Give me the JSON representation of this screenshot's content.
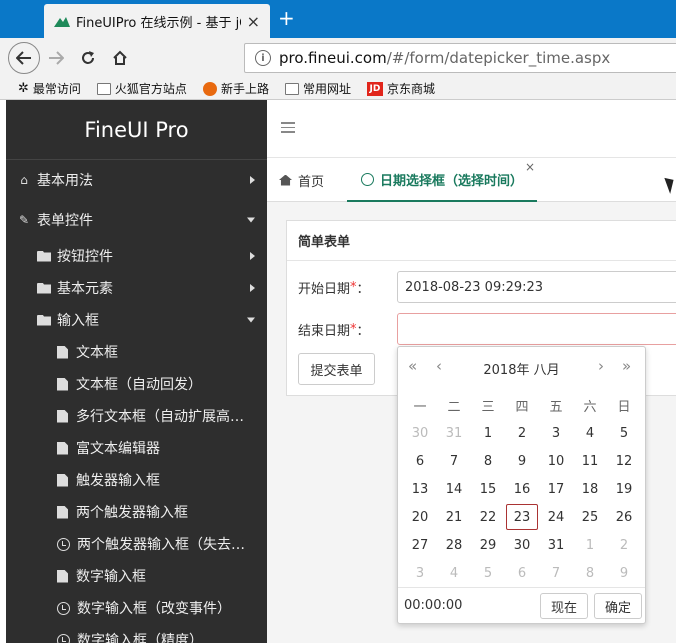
{
  "browser": {
    "tab_title": "FineUIPro 在线示例 - 基于 jQuery",
    "tab_close": "×",
    "new_tab": "+",
    "url_host": "pro.fineui.com",
    "url_path": "/#/form/datepicker_time.aspx",
    "bookmarks": [
      "最常访问",
      "火狐官方站点",
      "新手上路",
      "常用网址",
      "京东商城"
    ],
    "jd_logo": "JD"
  },
  "sidebar": {
    "brand": "FineUI Pro",
    "items": [
      {
        "label": "基本用法"
      },
      {
        "label": "表单控件"
      },
      {
        "label": "按钮控件"
      },
      {
        "label": "基本元素"
      },
      {
        "label": "输入框"
      },
      {
        "label": "文本框"
      },
      {
        "label": "文本框（自动回发）"
      },
      {
        "label": "多行文本框（自动扩展高度）"
      },
      {
        "label": "富文本编辑器"
      },
      {
        "label": "触发器输入框"
      },
      {
        "label": "两个触发器输入框"
      },
      {
        "label": "两个触发器输入框（失去焦点）"
      },
      {
        "label": "数字输入框"
      },
      {
        "label": "数字输入框（改变事件）"
      },
      {
        "label": "数字输入框（精度）"
      }
    ]
  },
  "tabs": {
    "home": "首页",
    "active": "日期选择框（选择时间）",
    "close": "×"
  },
  "form": {
    "title": "简单表单",
    "start_label": "开始日期",
    "end_label": "结束日期",
    "required_mark": "*",
    "colon": "：",
    "start_value": "2018-08-23 09:29:23",
    "end_value": "",
    "submit": "提交表单"
  },
  "picker": {
    "year_month": "2018年 八月",
    "prev_year": "«",
    "prev_month": "‹",
    "next_month": "›",
    "next_year": "»",
    "weekdays": [
      "一",
      "二",
      "三",
      "四",
      "五",
      "六",
      "日"
    ],
    "weeks": [
      [
        {
          "d": "30",
          "o": 1
        },
        {
          "d": "31",
          "o": 1
        },
        {
          "d": "1"
        },
        {
          "d": "2"
        },
        {
          "d": "3"
        },
        {
          "d": "4"
        },
        {
          "d": "5"
        }
      ],
      [
        {
          "d": "6"
        },
        {
          "d": "7"
        },
        {
          "d": "8"
        },
        {
          "d": "9"
        },
        {
          "d": "10"
        },
        {
          "d": "11"
        },
        {
          "d": "12"
        }
      ],
      [
        {
          "d": "13"
        },
        {
          "d": "14"
        },
        {
          "d": "15"
        },
        {
          "d": "16"
        },
        {
          "d": "17"
        },
        {
          "d": "18"
        },
        {
          "d": "19"
        }
      ],
      [
        {
          "d": "20"
        },
        {
          "d": "21"
        },
        {
          "d": "22"
        },
        {
          "d": "23",
          "s": 1
        },
        {
          "d": "24"
        },
        {
          "d": "25"
        },
        {
          "d": "26"
        }
      ],
      [
        {
          "d": "27"
        },
        {
          "d": "28"
        },
        {
          "d": "29"
        },
        {
          "d": "30"
        },
        {
          "d": "31"
        },
        {
          "d": "1",
          "o": 1
        },
        {
          "d": "2",
          "o": 1
        }
      ],
      [
        {
          "d": "3",
          "o": 1
        },
        {
          "d": "4",
          "o": 1
        },
        {
          "d": "5",
          "o": 1
        },
        {
          "d": "6",
          "o": 1
        },
        {
          "d": "7",
          "o": 1
        },
        {
          "d": "8",
          "o": 1
        },
        {
          "d": "9",
          "o": 1
        }
      ]
    ],
    "time": "00:00:00",
    "now_button": "现在",
    "ok_button": "确定"
  }
}
